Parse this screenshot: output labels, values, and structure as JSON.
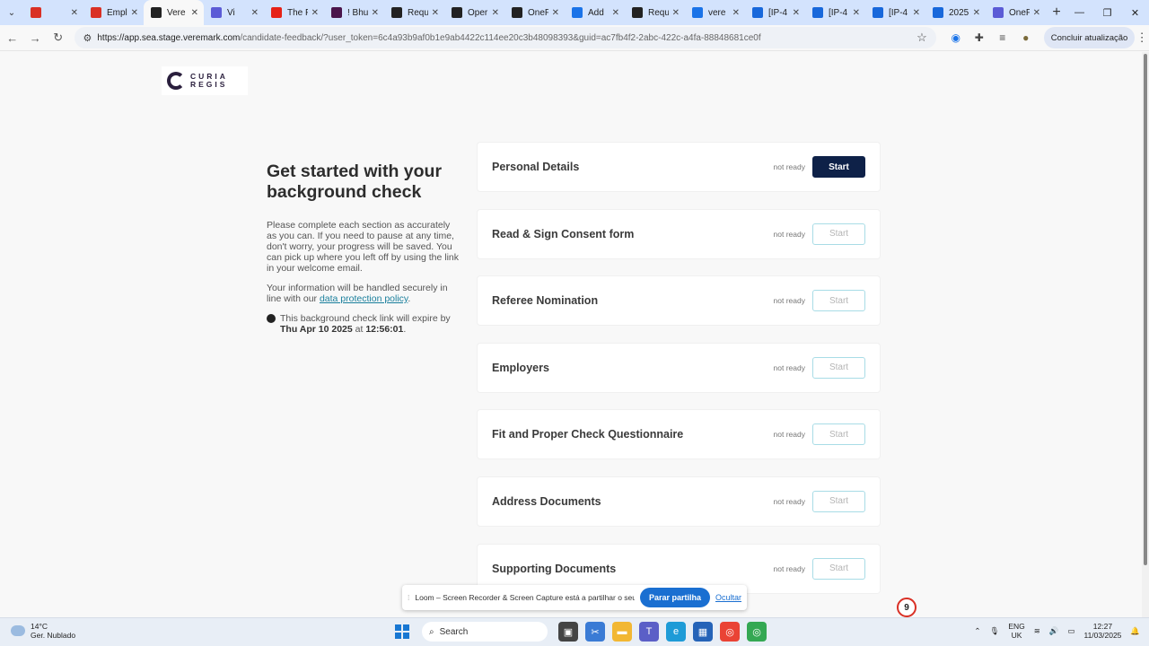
{
  "browser": {
    "tabs": [
      {
        "title": "",
        "icon": "record-icon",
        "color": "#d93025"
      },
      {
        "title": "Empl",
        "icon": "gmail-icon",
        "color": "#d93025"
      },
      {
        "title": "Vere",
        "icon": "veremark-icon",
        "color": "#222222",
        "active": true
      },
      {
        "title": "Vi",
        "icon": "gear-icon",
        "color": "#5b5bd6"
      },
      {
        "title": "The F",
        "icon": "youtube-icon",
        "color": "#e62117"
      },
      {
        "title": "! Bhu",
        "icon": "slack-icon",
        "color": "#4a154b"
      },
      {
        "title": "Requ",
        "icon": "veremark-icon",
        "color": "#222222"
      },
      {
        "title": "Oper",
        "icon": "veremark-icon",
        "color": "#222222"
      },
      {
        "title": "OneF",
        "icon": "github-icon",
        "color": "#222222"
      },
      {
        "title": "Add",
        "icon": "x-icon",
        "color": "#1a73e8"
      },
      {
        "title": "Requ",
        "icon": "veremark-icon",
        "color": "#222222"
      },
      {
        "title": "vere",
        "icon": "sheet-icon",
        "color": "#1a73e8"
      },
      {
        "title": "[IP-4",
        "icon": "confluence-icon",
        "color": "#1868db"
      },
      {
        "title": "[IP-4",
        "icon": "confluence-icon",
        "color": "#1868db"
      },
      {
        "title": "[IP-4",
        "icon": "confluence-icon",
        "color": "#1868db"
      },
      {
        "title": "2025",
        "icon": "confluence-icon",
        "color": "#1868db"
      },
      {
        "title": "OneF",
        "icon": "gear-icon",
        "color": "#5b5bd6"
      }
    ],
    "url_host": "https://app.sea.stage.veremark.com",
    "url_path": "/candidate-feedback/?user_token=6c4a93b9af0b1e9ab4422c114ee20c3b48098393&guid=ac7fb4f2-2abc-422c-a4fa-88848681ce0f",
    "update_label": "Concluir atualização"
  },
  "logo": {
    "line1": "CURIA",
    "line2": "REGIS"
  },
  "intro": {
    "heading": "Get started with your background check",
    "paragraph1": "Please complete each section as accurately as you can. If you need to pause at any time, don't worry, your progress will be saved. You can pick up where you left off by using the link in your welcome email.",
    "paragraph2_prefix": "Your information will be handled securely in line with our ",
    "paragraph2_link": "data protection policy",
    "paragraph2_suffix": ".",
    "expiry_prefix": "This background check link will expire by ",
    "expiry_date": "Thu Apr 10 2025",
    "expiry_at": " at ",
    "expiry_time": "12:56:01",
    "expiry_suffix": "."
  },
  "sections": [
    {
      "title": "Personal Details",
      "status": "not ready",
      "button": "Start",
      "primary": true
    },
    {
      "title": "Read & Sign Consent form",
      "status": "not ready",
      "button": "Start",
      "primary": false
    },
    {
      "title": "Referee Nomination",
      "status": "not ready",
      "button": "Start",
      "primary": false
    },
    {
      "title": "Employers",
      "status": "not ready",
      "button": "Start",
      "primary": false
    },
    {
      "title": "Fit and Proper Check Questionnaire",
      "status": "not ready",
      "button": "Start",
      "primary": false
    },
    {
      "title": "Address Documents",
      "status": "not ready",
      "button": "Start",
      "primary": false
    },
    {
      "title": "Supporting Documents",
      "status": "not ready",
      "button": "Start",
      "primary": false
    }
  ],
  "sharebar": {
    "message": "Loom – Screen Recorder & Screen Capture está a partilhar o seu ecrã.",
    "stop_label": "Parar partilha",
    "hide_label": "Ocultar"
  },
  "badge": {
    "count": "9"
  },
  "taskbar": {
    "temp": "14°C",
    "weather": "Ger. Nublado",
    "search_label": "Search",
    "lang1": "ENG",
    "lang2": "UK",
    "time": "12:27",
    "date": "11/03/2025"
  }
}
